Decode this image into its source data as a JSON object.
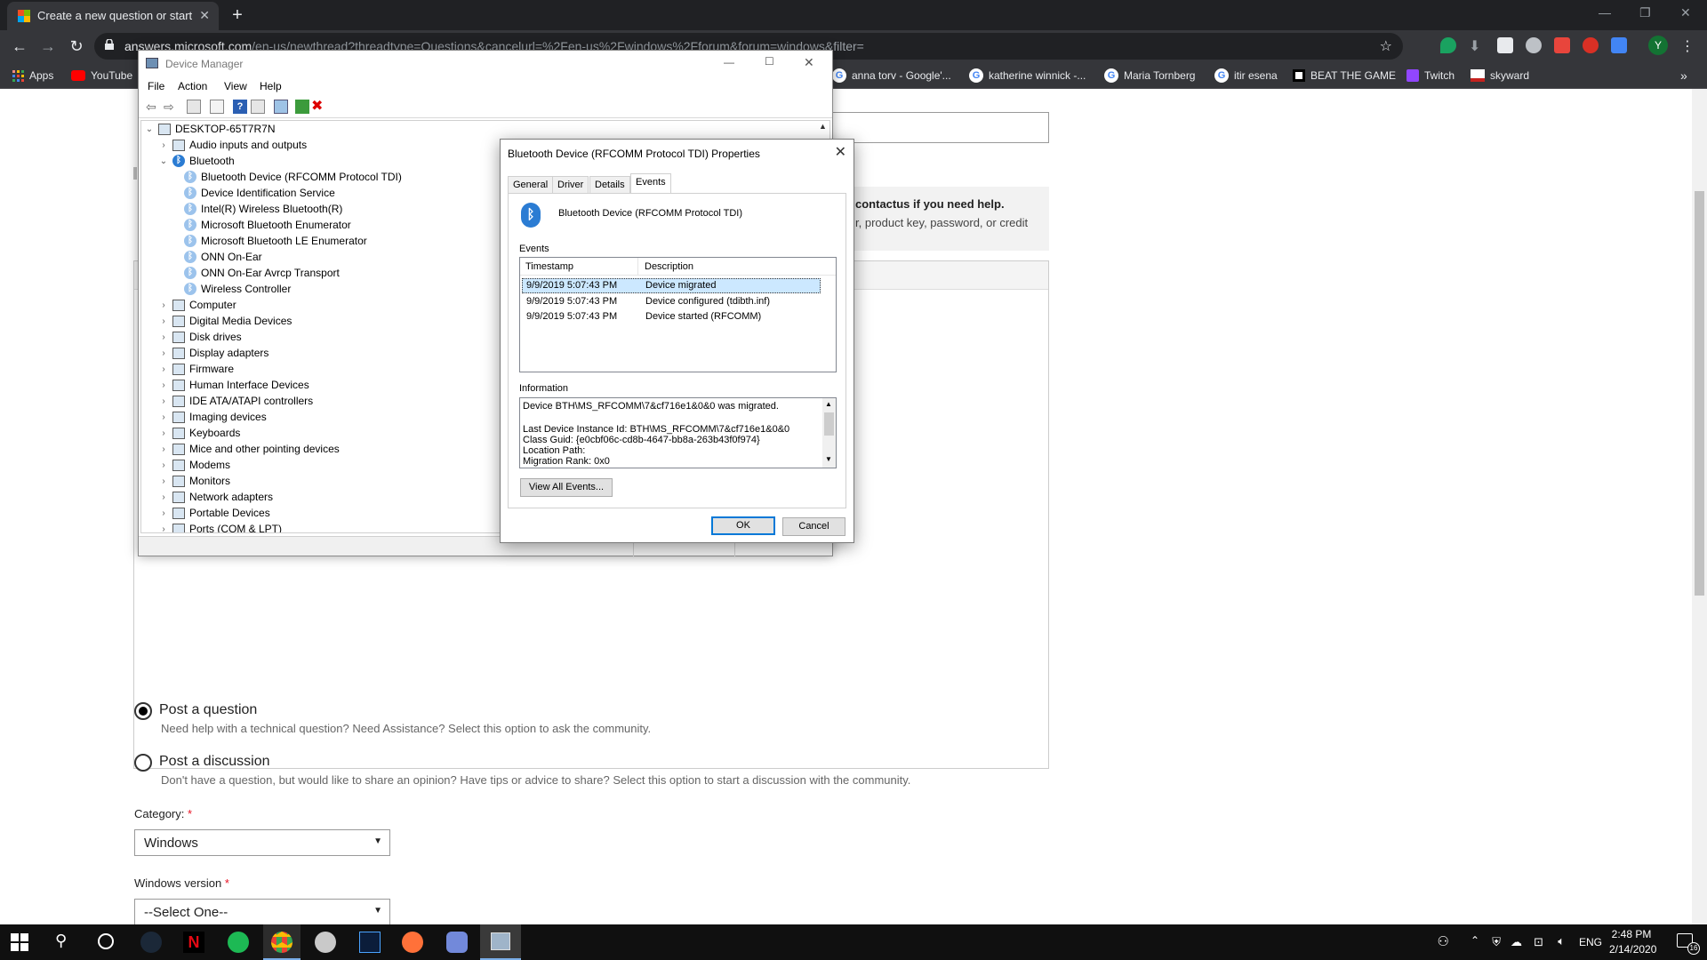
{
  "browser": {
    "tab_title": "Create a new question or start a",
    "url_host": "answers.microsoft.com",
    "url_path": "/en-us/newthread?threadtype=Questions&cancelurl=%2Fen-us%2Fwindows%2Fforum&forum=windows&filter=",
    "bookmarks": [
      {
        "label": "Apps"
      },
      {
        "label": "YouTube"
      },
      {
        "label": "anna torv - Google'..."
      },
      {
        "label": "katherine winnick -..."
      },
      {
        "label": "Maria Tornberg"
      },
      {
        "label": "itir esena"
      },
      {
        "label": "BEAT THE GAME"
      },
      {
        "label": "Twitch"
      },
      {
        "label": "skyward"
      }
    ],
    "more_bookmarks": "»",
    "profile_letter": "Y"
  },
  "page": {
    "banner_text_1": "contactus if you need help.",
    "banner_text_2": "r, product key, password, or credit",
    "options": [
      {
        "label": "Post a question",
        "desc": "Need help with a technical question? Need Assistance? Select this option to ask the community.",
        "selected": true
      },
      {
        "label": "Post a discussion",
        "desc": "Don't have a question, but would like to share an opinion? Have tips or advice to share? Select this option to start a discussion with the community.",
        "selected": false
      }
    ],
    "category_label": "Category:",
    "category_value": "Windows",
    "version_label": "Windows version",
    "version_value": "--Select One--",
    "required_mark": "*"
  },
  "device_manager": {
    "title": "Device Manager",
    "menu": [
      "File",
      "Action",
      "View",
      "Help"
    ],
    "root": "DESKTOP-65T7R7N",
    "tree": [
      {
        "label": "Audio inputs and outputs",
        "level": 1,
        "expanded": false
      },
      {
        "label": "Bluetooth",
        "level": 1,
        "expanded": true,
        "bt": true
      },
      {
        "label": "Bluetooth Device (RFCOMM Protocol TDI)",
        "level": 2,
        "bt": true
      },
      {
        "label": "Device Identification Service",
        "level": 2,
        "bt": true
      },
      {
        "label": "Intel(R) Wireless Bluetooth(R)",
        "level": 2,
        "bt": true
      },
      {
        "label": "Microsoft Bluetooth Enumerator",
        "level": 2,
        "bt": true
      },
      {
        "label": "Microsoft Bluetooth LE Enumerator",
        "level": 2,
        "bt": true
      },
      {
        "label": "ONN On-Ear",
        "level": 2,
        "bt": true
      },
      {
        "label": "ONN On-Ear Avrcp Transport",
        "level": 2,
        "bt": true
      },
      {
        "label": "Wireless Controller",
        "level": 2,
        "bt": true
      },
      {
        "label": "Computer",
        "level": 1,
        "expanded": false
      },
      {
        "label": "Digital Media Devices",
        "level": 1,
        "expanded": false
      },
      {
        "label": "Disk drives",
        "level": 1,
        "expanded": false
      },
      {
        "label": "Display adapters",
        "level": 1,
        "expanded": false
      },
      {
        "label": "Firmware",
        "level": 1,
        "expanded": false
      },
      {
        "label": "Human Interface Devices",
        "level": 1,
        "expanded": false
      },
      {
        "label": "IDE ATA/ATAPI controllers",
        "level": 1,
        "expanded": false
      },
      {
        "label": "Imaging devices",
        "level": 1,
        "expanded": false
      },
      {
        "label": "Keyboards",
        "level": 1,
        "expanded": false
      },
      {
        "label": "Mice and other pointing devices",
        "level": 1,
        "expanded": false
      },
      {
        "label": "Modems",
        "level": 1,
        "expanded": false
      },
      {
        "label": "Monitors",
        "level": 1,
        "expanded": false
      },
      {
        "label": "Network adapters",
        "level": 1,
        "expanded": false
      },
      {
        "label": "Portable Devices",
        "level": 1,
        "expanded": false
      },
      {
        "label": "Ports (COM & LPT)",
        "level": 1,
        "expanded": false
      }
    ]
  },
  "properties": {
    "title": "Bluetooth Device (RFCOMM Protocol TDI) Properties",
    "tabs": [
      "General",
      "Driver",
      "Details",
      "Events"
    ],
    "active_tab": "Events",
    "device_name": "Bluetooth Device (RFCOMM Protocol TDI)",
    "events_label": "Events",
    "col_timestamp": "Timestamp",
    "col_description": "Description",
    "events": [
      {
        "timestamp": "9/9/2019 5:07:43 PM",
        "description": "Device migrated"
      },
      {
        "timestamp": "9/9/2019 5:07:43 PM",
        "description": "Device configured (tdibth.inf)"
      },
      {
        "timestamp": "9/9/2019 5:07:43 PM",
        "description": "Device started (RFCOMM)"
      }
    ],
    "info_label": "Information",
    "info_lines": [
      "Device BTH\\MS_RFCOMM\\7&cf716e1&0&0 was migrated.",
      "",
      "Last Device Instance Id: BTH\\MS_RFCOMM\\7&cf716e1&0&0",
      "Class Guid: {e0cbf06c-cd8b-4647-bb8a-263b43f0f974}",
      "Location Path:",
      "Migration Rank: 0x0"
    ],
    "view_all_button": "View All Events...",
    "ok_button": "OK",
    "cancel_button": "Cancel"
  },
  "taskbar": {
    "lang": "ENG",
    "time": "2:48 PM",
    "date": "2/14/2020",
    "notifications": "16"
  }
}
